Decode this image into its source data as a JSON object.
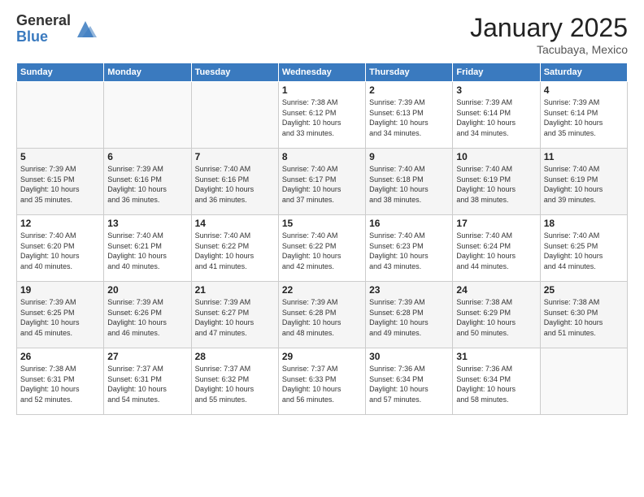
{
  "logo": {
    "general": "General",
    "blue": "Blue"
  },
  "header": {
    "title": "January 2025",
    "subtitle": "Tacubaya, Mexico"
  },
  "days_of_week": [
    "Sunday",
    "Monday",
    "Tuesday",
    "Wednesday",
    "Thursday",
    "Friday",
    "Saturday"
  ],
  "weeks": [
    [
      {
        "day": "",
        "info": ""
      },
      {
        "day": "",
        "info": ""
      },
      {
        "day": "",
        "info": ""
      },
      {
        "day": "1",
        "info": "Sunrise: 7:38 AM\nSunset: 6:12 PM\nDaylight: 10 hours\nand 33 minutes."
      },
      {
        "day": "2",
        "info": "Sunrise: 7:39 AM\nSunset: 6:13 PM\nDaylight: 10 hours\nand 34 minutes."
      },
      {
        "day": "3",
        "info": "Sunrise: 7:39 AM\nSunset: 6:14 PM\nDaylight: 10 hours\nand 34 minutes."
      },
      {
        "day": "4",
        "info": "Sunrise: 7:39 AM\nSunset: 6:14 PM\nDaylight: 10 hours\nand 35 minutes."
      }
    ],
    [
      {
        "day": "5",
        "info": "Sunrise: 7:39 AM\nSunset: 6:15 PM\nDaylight: 10 hours\nand 35 minutes."
      },
      {
        "day": "6",
        "info": "Sunrise: 7:39 AM\nSunset: 6:16 PM\nDaylight: 10 hours\nand 36 minutes."
      },
      {
        "day": "7",
        "info": "Sunrise: 7:40 AM\nSunset: 6:16 PM\nDaylight: 10 hours\nand 36 minutes."
      },
      {
        "day": "8",
        "info": "Sunrise: 7:40 AM\nSunset: 6:17 PM\nDaylight: 10 hours\nand 37 minutes."
      },
      {
        "day": "9",
        "info": "Sunrise: 7:40 AM\nSunset: 6:18 PM\nDaylight: 10 hours\nand 38 minutes."
      },
      {
        "day": "10",
        "info": "Sunrise: 7:40 AM\nSunset: 6:19 PM\nDaylight: 10 hours\nand 38 minutes."
      },
      {
        "day": "11",
        "info": "Sunrise: 7:40 AM\nSunset: 6:19 PM\nDaylight: 10 hours\nand 39 minutes."
      }
    ],
    [
      {
        "day": "12",
        "info": "Sunrise: 7:40 AM\nSunset: 6:20 PM\nDaylight: 10 hours\nand 40 minutes."
      },
      {
        "day": "13",
        "info": "Sunrise: 7:40 AM\nSunset: 6:21 PM\nDaylight: 10 hours\nand 40 minutes."
      },
      {
        "day": "14",
        "info": "Sunrise: 7:40 AM\nSunset: 6:22 PM\nDaylight: 10 hours\nand 41 minutes."
      },
      {
        "day": "15",
        "info": "Sunrise: 7:40 AM\nSunset: 6:22 PM\nDaylight: 10 hours\nand 42 minutes."
      },
      {
        "day": "16",
        "info": "Sunrise: 7:40 AM\nSunset: 6:23 PM\nDaylight: 10 hours\nand 43 minutes."
      },
      {
        "day": "17",
        "info": "Sunrise: 7:40 AM\nSunset: 6:24 PM\nDaylight: 10 hours\nand 44 minutes."
      },
      {
        "day": "18",
        "info": "Sunrise: 7:40 AM\nSunset: 6:25 PM\nDaylight: 10 hours\nand 44 minutes."
      }
    ],
    [
      {
        "day": "19",
        "info": "Sunrise: 7:39 AM\nSunset: 6:25 PM\nDaylight: 10 hours\nand 45 minutes."
      },
      {
        "day": "20",
        "info": "Sunrise: 7:39 AM\nSunset: 6:26 PM\nDaylight: 10 hours\nand 46 minutes."
      },
      {
        "day": "21",
        "info": "Sunrise: 7:39 AM\nSunset: 6:27 PM\nDaylight: 10 hours\nand 47 minutes."
      },
      {
        "day": "22",
        "info": "Sunrise: 7:39 AM\nSunset: 6:28 PM\nDaylight: 10 hours\nand 48 minutes."
      },
      {
        "day": "23",
        "info": "Sunrise: 7:39 AM\nSunset: 6:28 PM\nDaylight: 10 hours\nand 49 minutes."
      },
      {
        "day": "24",
        "info": "Sunrise: 7:38 AM\nSunset: 6:29 PM\nDaylight: 10 hours\nand 50 minutes."
      },
      {
        "day": "25",
        "info": "Sunrise: 7:38 AM\nSunset: 6:30 PM\nDaylight: 10 hours\nand 51 minutes."
      }
    ],
    [
      {
        "day": "26",
        "info": "Sunrise: 7:38 AM\nSunset: 6:31 PM\nDaylight: 10 hours\nand 52 minutes."
      },
      {
        "day": "27",
        "info": "Sunrise: 7:37 AM\nSunset: 6:31 PM\nDaylight: 10 hours\nand 54 minutes."
      },
      {
        "day": "28",
        "info": "Sunrise: 7:37 AM\nSunset: 6:32 PM\nDaylight: 10 hours\nand 55 minutes."
      },
      {
        "day": "29",
        "info": "Sunrise: 7:37 AM\nSunset: 6:33 PM\nDaylight: 10 hours\nand 56 minutes."
      },
      {
        "day": "30",
        "info": "Sunrise: 7:36 AM\nSunset: 6:34 PM\nDaylight: 10 hours\nand 57 minutes."
      },
      {
        "day": "31",
        "info": "Sunrise: 7:36 AM\nSunset: 6:34 PM\nDaylight: 10 hours\nand 58 minutes."
      },
      {
        "day": "",
        "info": ""
      }
    ]
  ]
}
